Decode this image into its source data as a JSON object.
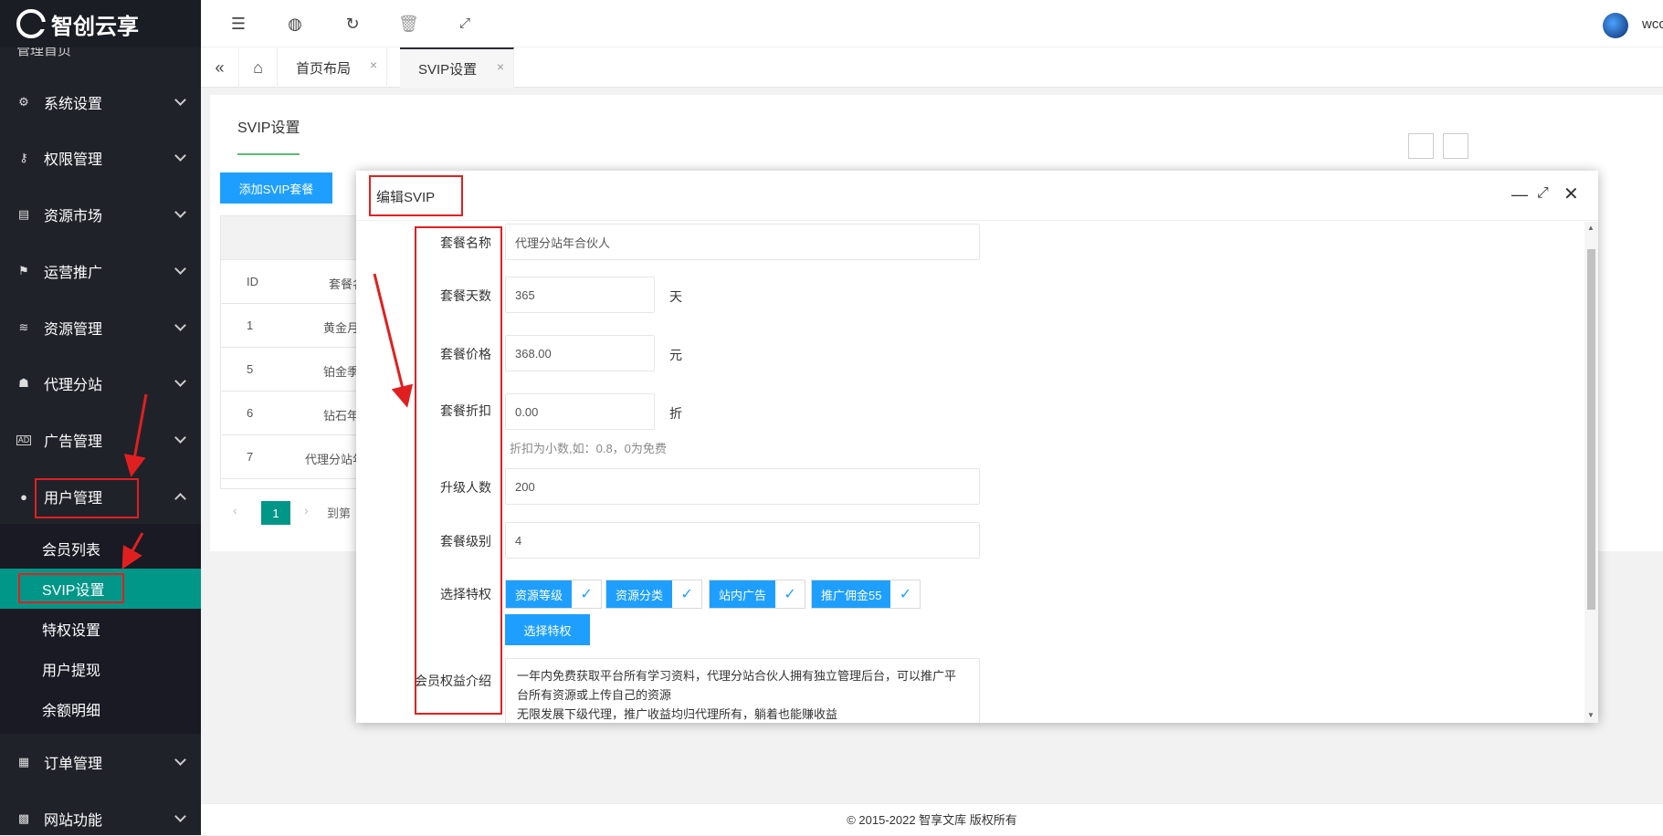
{
  "sidebar": {
    "logo": "智创云享",
    "cut_item": "管理首页",
    "items": [
      {
        "label": "系统设置",
        "icon": "gear-icon"
      },
      {
        "label": "权限管理",
        "icon": "key-icon"
      },
      {
        "label": "资源市场",
        "icon": "store-icon"
      },
      {
        "label": "运营推广",
        "icon": "flag-icon"
      },
      {
        "label": "资源管理",
        "icon": "layers-icon"
      },
      {
        "label": "代理分站",
        "icon": "users-icon"
      },
      {
        "label": "广告管理",
        "icon": "ad-icon"
      },
      {
        "label": "用户管理",
        "icon": "user-icon"
      },
      {
        "label": "订单管理",
        "icon": "clipboard-icon"
      },
      {
        "label": "网站功能",
        "icon": "grid-icon"
      }
    ],
    "submenu": [
      "会员列表",
      "SVIP设置",
      "特权设置",
      "用户提现",
      "余额明细"
    ]
  },
  "header": {
    "user": "wcc"
  },
  "tabs": {
    "home": "首页布局",
    "current": "SVIP设置"
  },
  "page": {
    "title": "SVIP设置",
    "add_button": "添加SVIP套餐",
    "table": {
      "headers": [
        "ID",
        "套餐名"
      ],
      "rows": [
        {
          "id": "1",
          "name": "黄金月"
        },
        {
          "id": "5",
          "name": "铂金季"
        },
        {
          "id": "6",
          "name": "钻石年"
        },
        {
          "id": "7",
          "name": "代理分站年"
        }
      ],
      "page": "1",
      "goto": "到第"
    }
  },
  "modal": {
    "title": "编辑SVIP",
    "fields": {
      "name_label": "套餐名称",
      "name_value": "代理分站年合伙人",
      "days_label": "套餐天数",
      "days_value": "365",
      "days_unit": "天",
      "price_label": "套餐价格",
      "price_value": "368.00",
      "price_unit": "元",
      "discount_label": "套餐折扣",
      "discount_value": "0.00",
      "discount_unit": "折",
      "discount_hint": "折扣为小数,如：0.8，0为免费",
      "upgrade_label": "升级人数",
      "upgrade_value": "200",
      "level_label": "套餐级别",
      "level_value": "4",
      "privilege_label": "选择特权",
      "privileges": [
        "资源等级",
        "资源分类",
        "站内广告",
        "推广佣金55"
      ],
      "select_privilege_button": "选择特权",
      "intro_label": "会员权益介绍",
      "intro_lines": [
        "一年内免费获取平台所有学习资料，代理分站合伙人拥有独立管理后台，可以推广平",
        "台所有资源或上传自己的资源",
        "无限发展下级代理，推广收益均归代理所有，躺着也能赚收益"
      ]
    }
  },
  "footer": "© 2015-2022 智享文库 版权所有",
  "colors": {
    "sidebar_bg": "#20222a",
    "active_green": "#009688",
    "primary_blue": "#1e9fff",
    "annotation_red": "#e02020"
  }
}
